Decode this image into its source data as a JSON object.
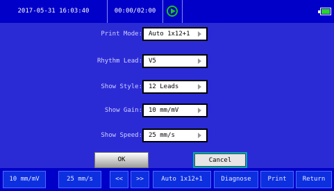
{
  "status_bar": {
    "datetime": "2017-05-31 16:03:40",
    "record_timer": "00:00/02:00",
    "play_icon": "play-circle-icon",
    "battery_icon": "battery-icon",
    "play_color": "#1ec11e",
    "battery_fill_color": "#2fd12f"
  },
  "settings": {
    "print_mode": {
      "label": "Print Mode:",
      "value": "Auto 1x12+1"
    },
    "rhythm_lead": {
      "label": "Rhythm Lead:",
      "value": "V5"
    },
    "show_style": {
      "label": "Show Style:",
      "value": "12 Leads"
    },
    "show_gain": {
      "label": "Show Gain:",
      "value": "10 mm/mV"
    },
    "show_speed": {
      "label": "Show Speed:",
      "value": "25 mm/s"
    }
  },
  "dialog_buttons": {
    "ok": "OK",
    "cancel": "Cancel"
  },
  "soft_keys": {
    "gain": "10 mm/mV",
    "speed": "25 mm/s",
    "prev": "<<",
    "next": ">>",
    "print_mode": "Auto 1x12+1",
    "diagnose": "Diagnose",
    "print": "Print",
    "return": "Return"
  },
  "colors": {
    "background": "#2b2bd6",
    "bar": "#0000c8",
    "focus_border": "#00a8b8"
  }
}
